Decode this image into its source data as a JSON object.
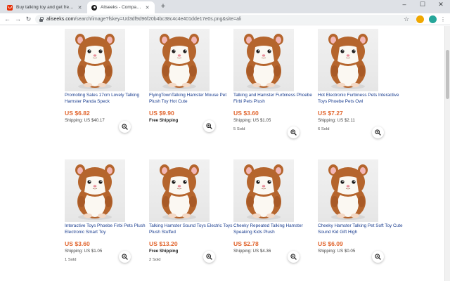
{
  "browser": {
    "tabs": [
      {
        "title": "Buy talking toy and get free shipp",
        "active": false,
        "favicon": "aliexpress-icon"
      },
      {
        "title": "Aliseeks - Compare Aliexpress pr",
        "active": true,
        "favicon": "aliseeks-icon"
      }
    ],
    "new_tab": "+",
    "window_controls": {
      "minimize": "–",
      "maximize": "☐",
      "close": "✕"
    },
    "url_domain": "aliseeks.com",
    "url_path": "/search/image?fskey=Ud3df9d96f20b4bc38c4c4e401dde17e0s.png&site=ali",
    "back": "←",
    "forward": "→",
    "reload": "↻"
  },
  "products": [
    {
      "title": "Promoting Sales 17cm Lovely Talking Hamster Panda Speck",
      "price": "US $6.82",
      "shipping": "Shipping: US $40.17",
      "sold": ""
    },
    {
      "title": "FlyingTownTalking Hamster Mouse Pet Plush Toy Hot Cute",
      "price": "US $9.90",
      "shipping": "Free Shipping",
      "sold": ""
    },
    {
      "title": "Talking and Hamster Furbiness Phoebe Firbi Pets Plush",
      "price": "US $3.60",
      "shipping": "Shipping: US $1.05",
      "sold": "5 Sold"
    },
    {
      "title": "Hot Electronic Furbiness Pets Interactive Toys Phoebe Pets Owl",
      "price": "US $7.27",
      "shipping": "Shipping: US $2.11",
      "sold": "6 Sold"
    },
    {
      "title": "Interactive Toys Phoebe Firbi Pets Plush Electronic Smart Toy",
      "price": "US $3.60",
      "shipping": "Shipping: US $1.05",
      "sold": "1 Sold"
    },
    {
      "title": "Talking Hamster Sound Toys Electric Toys Plush Stuffed",
      "price": "US $13.20",
      "shipping": "Free Shipping",
      "sold": "2 Sold"
    },
    {
      "title": "Cheeky Repeated Talking Hamster Speaking Kids Plush",
      "price": "US $2.78",
      "shipping": "Shipping: US $4.36",
      "sold": ""
    },
    {
      "title": "Cheeky Hamster Talking Pet Soft Toy Cute Sound Kid Gift High",
      "price": "US $6.09",
      "shipping": "Shipping: US $0.05",
      "sold": ""
    }
  ],
  "colors": {
    "title_link": "#1a3d8f",
    "price": "#e1662f",
    "hamster_fur": "#b5652d"
  }
}
